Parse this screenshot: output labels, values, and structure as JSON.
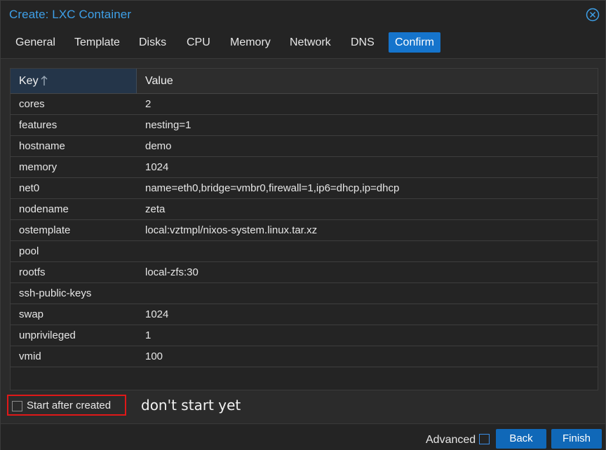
{
  "window": {
    "title": "Create: LXC Container"
  },
  "tabs": [
    {
      "label": "General"
    },
    {
      "label": "Template"
    },
    {
      "label": "Disks"
    },
    {
      "label": "CPU"
    },
    {
      "label": "Memory"
    },
    {
      "label": "Network"
    },
    {
      "label": "DNS"
    },
    {
      "label": "Confirm",
      "active": true
    }
  ],
  "grid": {
    "columns": {
      "key": "Key",
      "value": "Value"
    },
    "sort": {
      "column": "Key",
      "direction": "ascending",
      "icon": "arrow-up-icon"
    },
    "rows": [
      {
        "key": "cores",
        "value": "2"
      },
      {
        "key": "features",
        "value": "nesting=1"
      },
      {
        "key": "hostname",
        "value": "demo"
      },
      {
        "key": "memory",
        "value": "1024"
      },
      {
        "key": "net0",
        "value": "name=eth0,bridge=vmbr0,firewall=1,ip6=dhcp,ip=dhcp"
      },
      {
        "key": "nodename",
        "value": "zeta"
      },
      {
        "key": "ostemplate",
        "value": "local:vztmpl/nixos-system.linux.tar.xz"
      },
      {
        "key": "pool",
        "value": ""
      },
      {
        "key": "rootfs",
        "value": "local-zfs:30"
      },
      {
        "key": "ssh-public-keys",
        "value": ""
      },
      {
        "key": "swap",
        "value": "1024"
      },
      {
        "key": "unprivileged",
        "value": "1"
      },
      {
        "key": "vmid",
        "value": "100"
      }
    ]
  },
  "options": {
    "start_after_created": {
      "label": "Start after created",
      "checked": false
    }
  },
  "annotation": {
    "text": "don't start yet",
    "highlight_color": "#e01818"
  },
  "footer": {
    "advanced_label": "Advanced",
    "advanced_checked": false,
    "back_label": "Back",
    "finish_label": "Finish"
  },
  "colors": {
    "accent": "#1574cc",
    "title": "#3ea0e8",
    "background": "#2b2b2b"
  }
}
